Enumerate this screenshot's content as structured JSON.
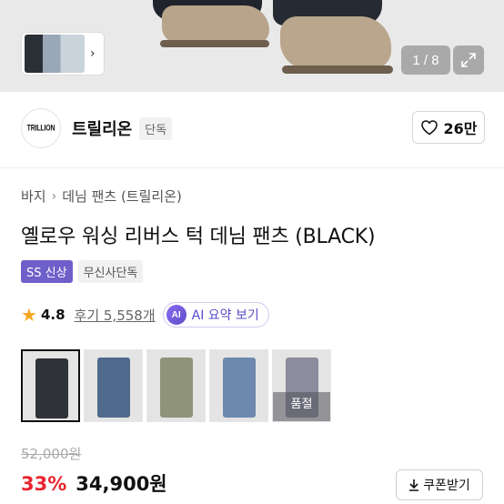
{
  "gallery": {
    "pager": "1 / 8",
    "thumb_arrow": "›"
  },
  "brand": {
    "logo_text": "TRILLION",
    "name": "트릴리온",
    "badge": "단독",
    "like_count": "26만"
  },
  "breadcrumb": {
    "items": [
      "바지",
      "데님 팬츠 (트릴리온)"
    ],
    "separator": "›"
  },
  "product": {
    "title": "옐로우 워싱 리버스 턱 데님 팬츠 (BLACK)",
    "tags": [
      "SS 신상",
      "무신사단독"
    ]
  },
  "rating": {
    "score": "4.8",
    "reviews": "후기 5,558개",
    "ai_icon": "AI",
    "ai_label": "AI 요약 보기"
  },
  "variants": {
    "colors": [
      "#2f3238",
      "#4f6a8c",
      "#8e937a",
      "#6d89ad",
      "#8b8d9c"
    ],
    "soldout_label": "품절"
  },
  "price": {
    "original": "52,000원",
    "discount": "33%",
    "sale": "34,900원"
  },
  "coupon": {
    "label": "쿠폰받기"
  },
  "colors": {
    "accent_purple": "#6f5fc9",
    "discount_red": "#e8252f",
    "star": "#f5a623"
  }
}
